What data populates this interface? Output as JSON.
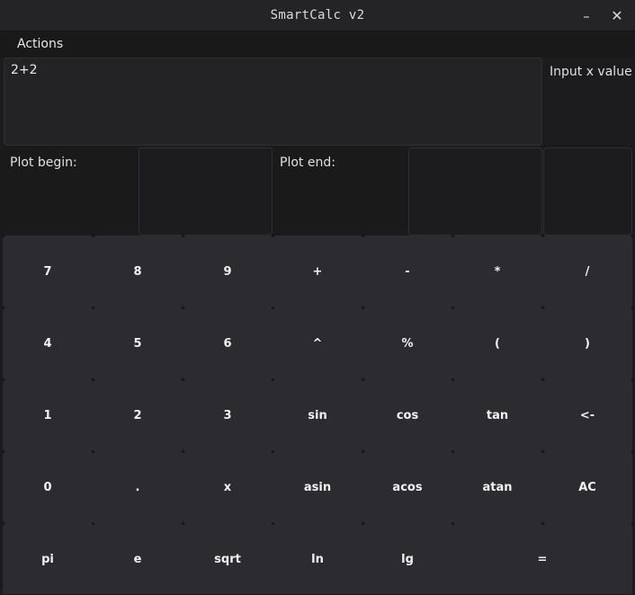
{
  "window": {
    "title": "SmartCalc v2",
    "minimize_glyph": "–",
    "close_glyph": "✕"
  },
  "menu": {
    "actions_label": "Actions"
  },
  "expression": {
    "value": "2+2"
  },
  "x_input": {
    "label": "Input x value",
    "value": ""
  },
  "plot": {
    "begin_label": "Plot begin:",
    "begin_value": "",
    "end_label": "Plot end:",
    "end_value": "",
    "extra_value": ""
  },
  "keypad": {
    "rows": [
      [
        "7",
        "8",
        "9",
        "+",
        "-",
        "*",
        "/"
      ],
      [
        "4",
        "5",
        "6",
        "^",
        "%",
        "(",
        ")"
      ],
      [
        "1",
        "2",
        "3",
        "sin",
        "cos",
        "tan",
        "<-"
      ],
      [
        "0",
        ".",
        "x",
        "asin",
        "acos",
        "atan",
        "AC"
      ],
      [
        "pi",
        "e",
        "sqrt",
        "ln",
        "lg",
        "="
      ]
    ]
  },
  "colors": {
    "background": "#1c1c1e",
    "keypad": "#2b2b30",
    "text": "#f2f2f2"
  }
}
